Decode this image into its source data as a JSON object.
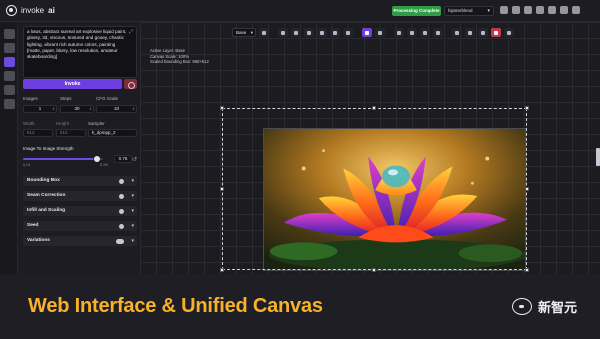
{
  "app": {
    "logo_prefix": "invoke",
    "logo_suffix": "ai"
  },
  "header": {
    "status": "Processing Complete",
    "model": "hipsterblend",
    "icons": [
      "keyboard-icon",
      "cube-icon",
      "globe-icon",
      "settings-icon",
      "discord-icon",
      "github-icon",
      "moon-icon"
    ]
  },
  "rail": {
    "active_index": 2,
    "items": [
      "text-to-image-icon",
      "image-to-image-icon",
      "unified-canvas-icon",
      "nodes-icon",
      "postprocess-icon",
      "training-icon"
    ]
  },
  "options": {
    "prompt": "a lotus, abstract surreal art explosive liquid paint, glossy, 3d, viscous, textured and gooey, chaotic lighting, vibrant rich autumn colors, painting [matte, paper, blurry, low resolution, amateur skateboarding]",
    "invoke_label": "Invoke",
    "images_label": "Images",
    "images_value": "1",
    "steps_label": "Steps",
    "steps_value": "30",
    "cfg_label": "CFG Scale",
    "cfg_value": "10",
    "width_label": "Width",
    "width_value": "512",
    "height_label": "Height",
    "height_value": "512",
    "sampler_label": "Sampler",
    "sampler_value": "k_dpmpp_2",
    "strength_label": "Image To Image Strength",
    "strength_value": "0.75",
    "strength_fraction": 0.93,
    "strength_min": "0.01",
    "strength_max": "0.99",
    "sections": [
      "Bounding Box",
      "Seam Correction",
      "Infill and Scaling",
      "Seed",
      "Variations"
    ]
  },
  "canvas": {
    "layer_select": "Base",
    "info_line1": "Active Layer: Base",
    "info_line2": "Canvas Scale: 100%",
    "info_line3": "Scaled Bounding Box: 960×512"
  },
  "banner": {
    "title": "Web Interface & Unified Canvas",
    "brand": "新智元"
  },
  "colors": {
    "accent": "#6d3fe0",
    "status": "#2f9c46",
    "banner_title": "#f7b22a",
    "danger": "#c23a4a"
  }
}
